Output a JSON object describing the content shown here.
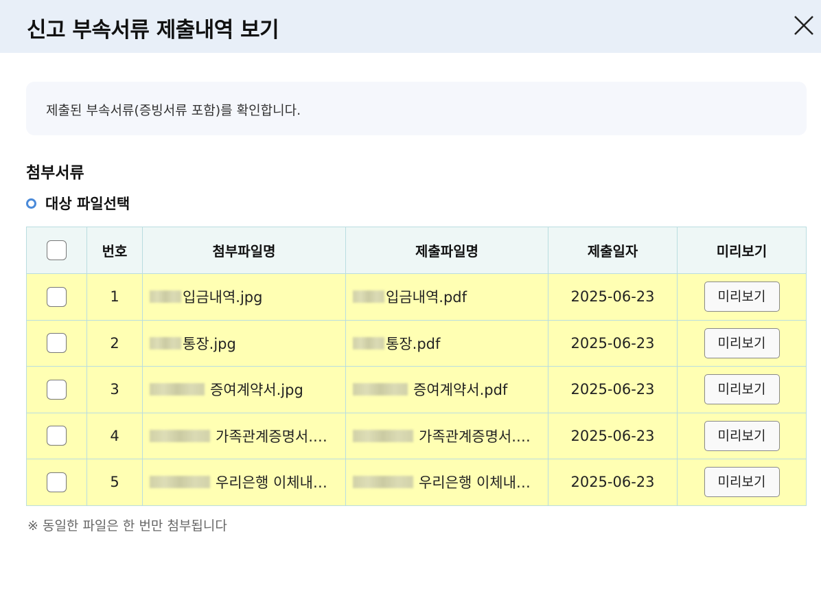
{
  "dialog": {
    "title": "신고 부속서류 제출내역 보기",
    "close_icon": "close-icon"
  },
  "info": {
    "message": "제출된 부속서류(증빙서류 포함)를 확인합니다."
  },
  "section": {
    "title": "첨부서류",
    "subtitle": "대상 파일선택"
  },
  "table": {
    "headers": {
      "number": "번호",
      "attach_name": "첨부파일명",
      "submit_name": "제출파일명",
      "date": "제출일자",
      "preview": "미리보기"
    },
    "rows": [
      {
        "no": "1",
        "attach": "입금내역.jpg",
        "submit": "입금내역.pdf",
        "date": "2025-06-23",
        "preview_label": "미리보기",
        "checked": false
      },
      {
        "no": "2",
        "attach": "통장.jpg",
        "submit": "통장.pdf",
        "date": "2025-06-23",
        "preview_label": "미리보기",
        "checked": false
      },
      {
        "no": "3",
        "attach": "증여계약서.jpg",
        "submit": "증여계약서.pdf",
        "date": "2025-06-23",
        "preview_label": "미리보기",
        "checked": false
      },
      {
        "no": "4",
        "attach": "가족관계증명서.…",
        "submit": "가족관계증명서.…",
        "date": "2025-06-23",
        "preview_label": "미리보기",
        "checked": false
      },
      {
        "no": "5",
        "attach": "우리은행 이체내…",
        "submit": "우리은행 이체내…",
        "date": "2025-06-23",
        "preview_label": "미리보기",
        "checked": false
      }
    ]
  },
  "note": "※ 동일한 파일은 한 번만 첨부됩니다",
  "colors": {
    "header_bg": "#e8eff8",
    "row_highlight": "#ffffb3",
    "table_header_bg": "#eef7f6",
    "accent": "#4a8ad9"
  }
}
